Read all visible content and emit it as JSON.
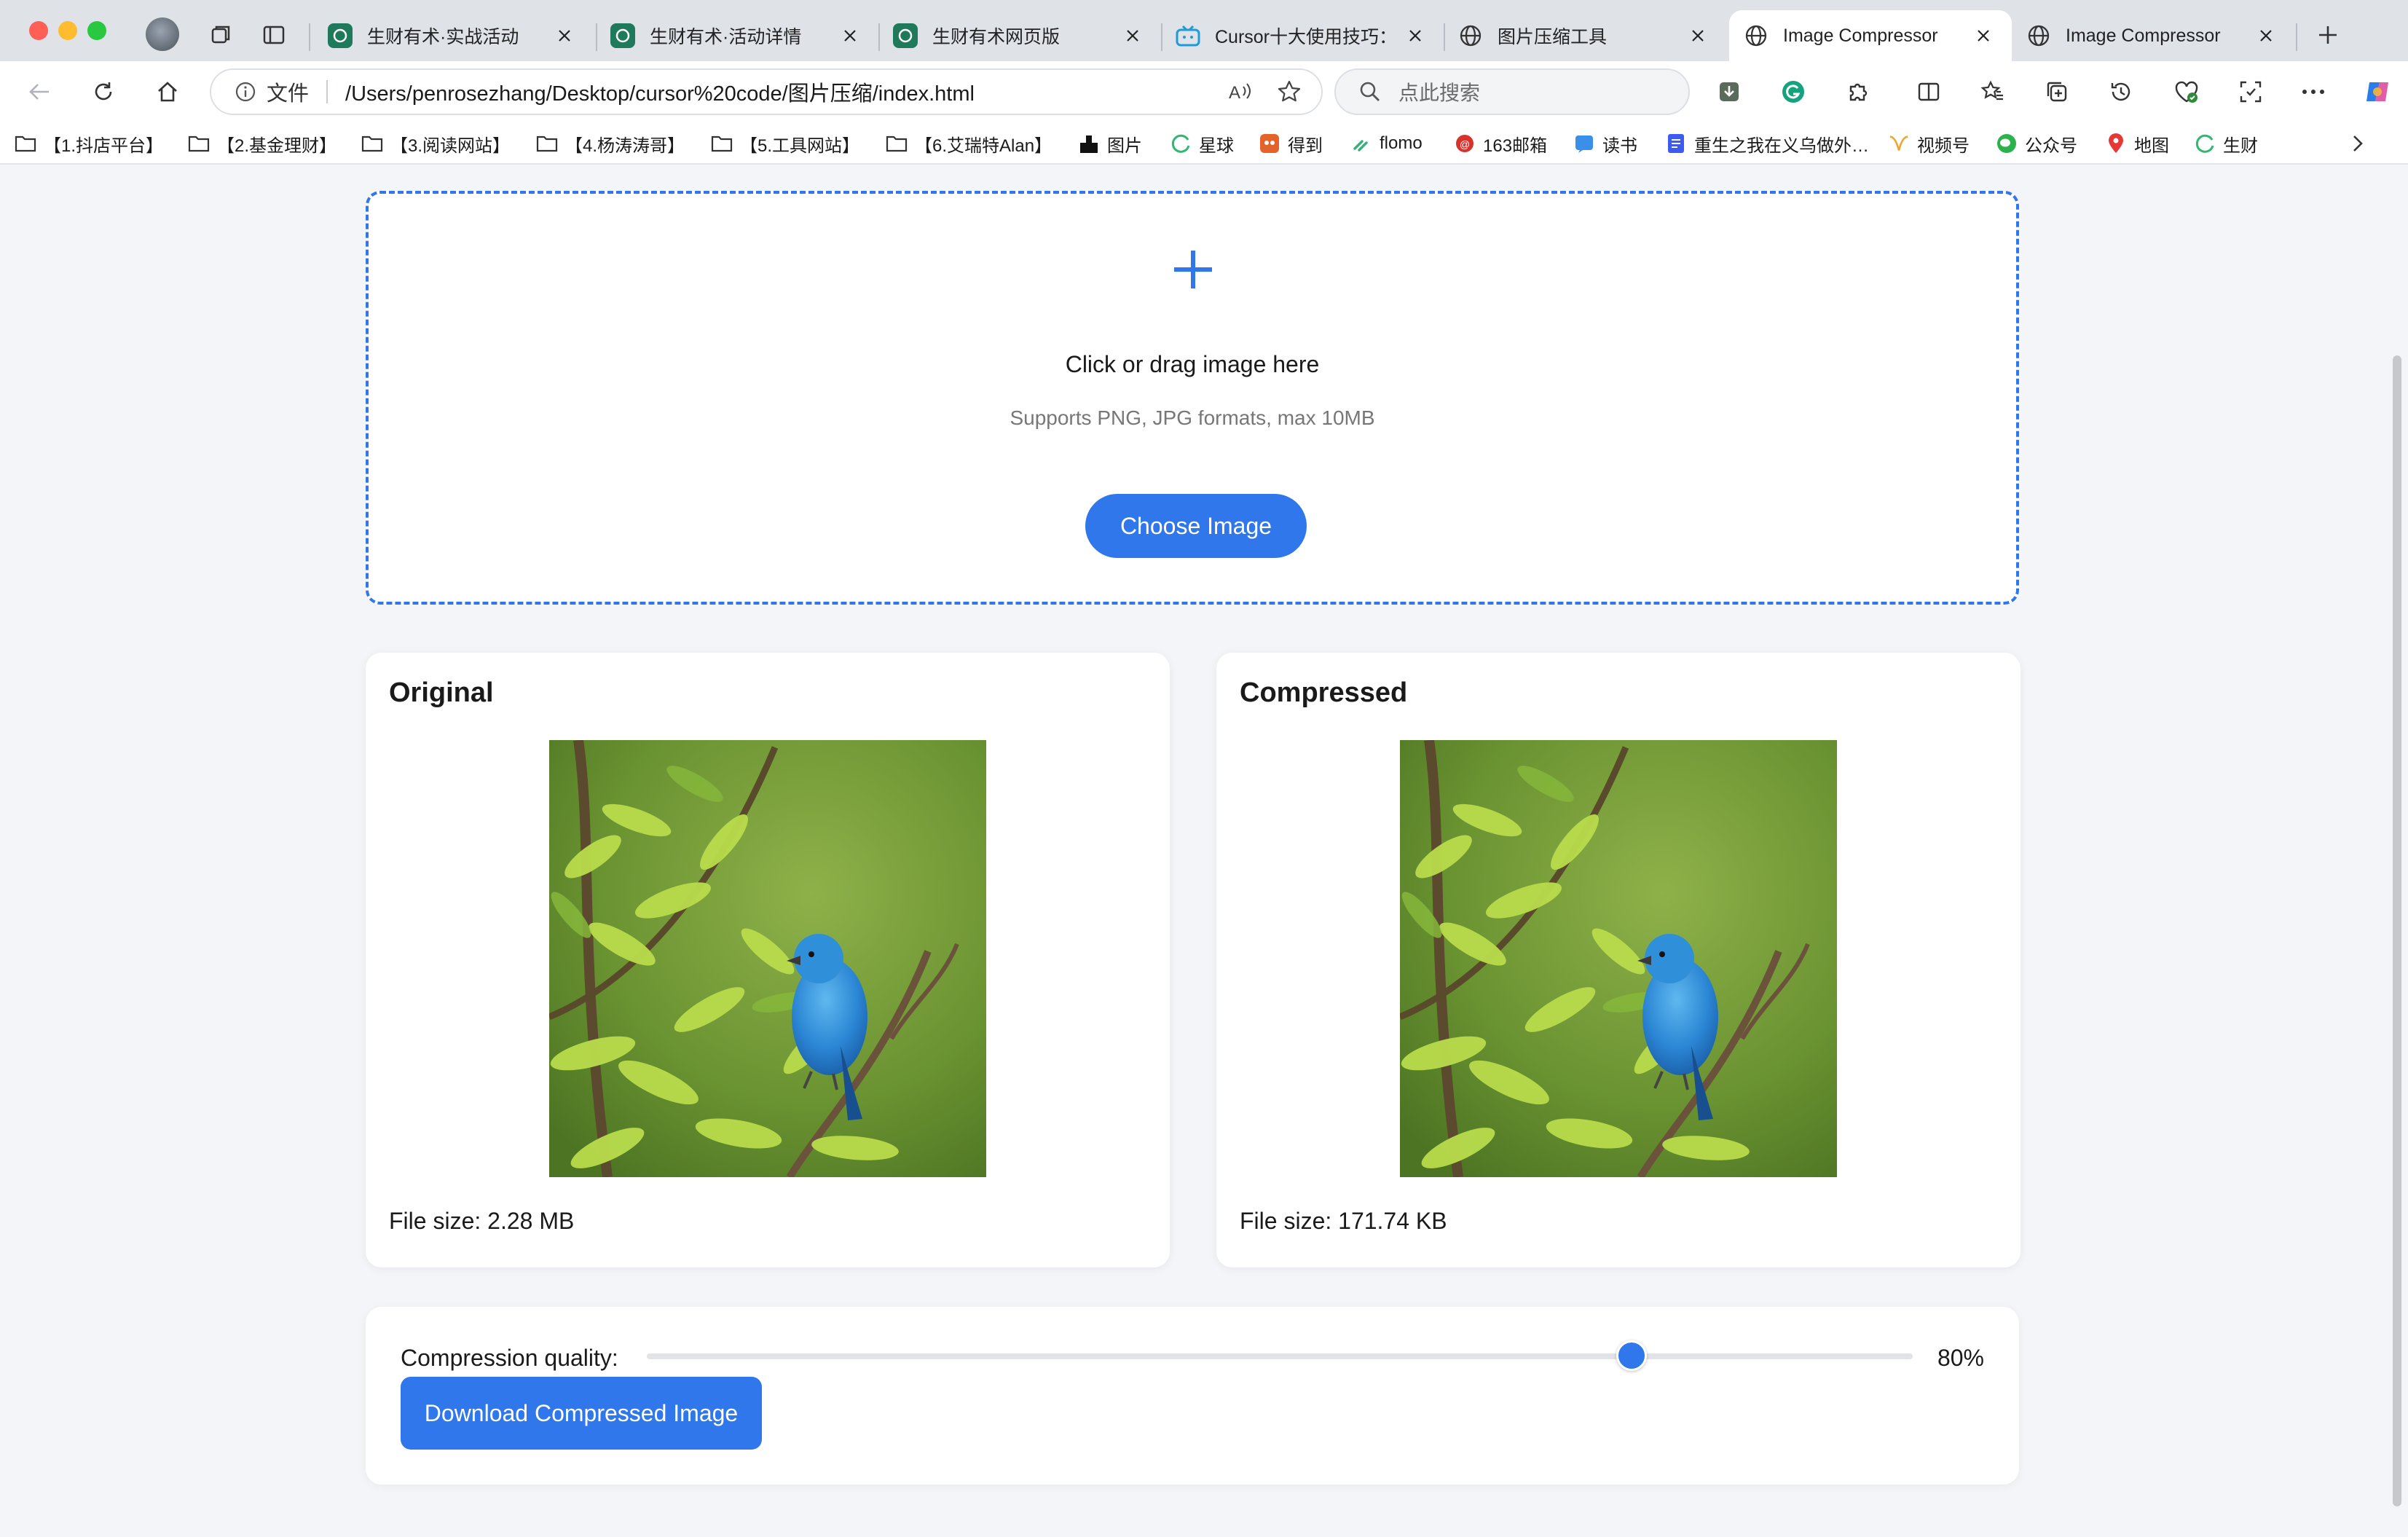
{
  "browser": {
    "tabs": [
      {
        "title": "生财有术·实战活动",
        "icon": "shengcai-favicon"
      },
      {
        "title": "生财有术·活动详情",
        "icon": "shengcai-favicon"
      },
      {
        "title": "生财有术网页版",
        "icon": "shengcai-favicon"
      },
      {
        "title": "Cursor十大使用技巧：免",
        "icon": "bilibili-favicon"
      },
      {
        "title": "图片压缩工具",
        "icon": "globe-favicon"
      },
      {
        "title": "Image Compressor",
        "icon": "globe-favicon",
        "active": true
      },
      {
        "title": "Image Compressor",
        "icon": "globe-favicon"
      }
    ],
    "address": {
      "info_label": "文件",
      "url": "/Users/penrosezhang/Desktop/cursor%20code/图片压缩/index.html"
    },
    "search_placeholder": "点此搜索",
    "bookmarks": [
      {
        "label": "【1.抖店平台】",
        "icon": "folder-icon"
      },
      {
        "label": "【2.基金理财】",
        "icon": "folder-icon"
      },
      {
        "label": "【3.阅读网站】",
        "icon": "folder-icon"
      },
      {
        "label": "【4.杨涛涛哥】",
        "icon": "folder-icon"
      },
      {
        "label": "【5.工具网站】",
        "icon": "folder-icon"
      },
      {
        "label": "【6.艾瑞特Alan】",
        "icon": "folder-icon"
      },
      {
        "label": "图片",
        "icon": "image-site-icon"
      },
      {
        "label": "星球",
        "icon": "planet-icon"
      },
      {
        "label": "得到",
        "icon": "dedao-icon"
      },
      {
        "label": "flomo",
        "icon": "flomo-icon"
      },
      {
        "label": "163邮箱",
        "icon": "mail163-icon"
      },
      {
        "label": "读书",
        "icon": "weread-icon"
      },
      {
        "label": "重生之我在义乌做外…",
        "icon": "doc-icon"
      },
      {
        "label": "视频号",
        "icon": "channels-icon"
      },
      {
        "label": "公众号",
        "icon": "wechat-icon"
      },
      {
        "label": "地图",
        "icon": "map-pin-icon"
      },
      {
        "label": "生财",
        "icon": "planet-icon"
      }
    ]
  },
  "upload": {
    "title": "Click or drag image here",
    "hint": "Supports PNG, JPG formats, max 10MB",
    "button_label": "Choose Image"
  },
  "original": {
    "heading": "Original",
    "file_size": "File size: 2.28 MB"
  },
  "compressed": {
    "heading": "Compressed",
    "file_size": "File size: 171.74 KB"
  },
  "controls": {
    "quality_label": "Compression quality:",
    "quality_value": 0.8,
    "quality_text": "80%",
    "download_label": "Download Compressed Image"
  },
  "colors": {
    "accent": "#2f77ea",
    "page_bg": "#f4f5f8"
  }
}
